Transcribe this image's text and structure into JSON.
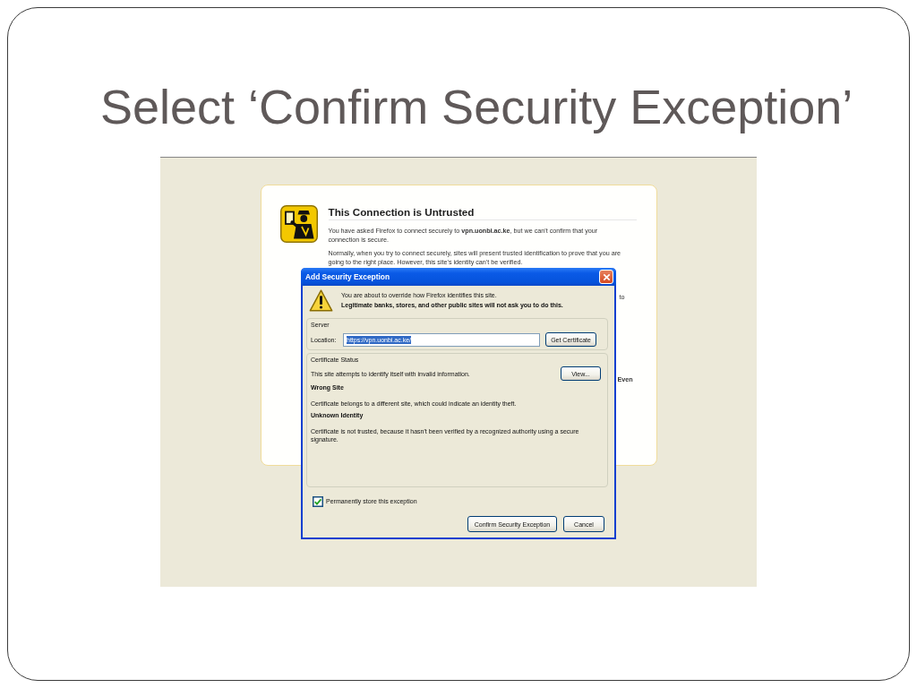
{
  "slide": {
    "title": "Select ‘Confirm Security Exception’"
  },
  "screenshot": {
    "error_page": {
      "title": "This Connection is Untrusted",
      "paragraphs": [
        "You have asked Firefox to connect securely to **vpn.uonbi.ac.ke**, but we can't confirm that your connection is secure.",
        "Normally, when you try to connect securely, sites will present trusted identification to prove that you are going to the right place. However, this site's identity can't be verified."
      ],
      "covered_fragments": [
        {
          "text": "to",
          "bold": false
        },
        {
          "text": "Even",
          "bold": true
        }
      ]
    },
    "dialog": {
      "title": "Add Security Exception",
      "warning": {
        "text": "You are about to override how Firefox identifies this site.",
        "emphasis": "Legitimate banks, stores, and other public sites will not ask you to do this."
      },
      "server": {
        "caption": "Server",
        "location_label": "Location:",
        "location_value": "https://vpn.uonbi.ac.ke/",
        "location_selected": true,
        "button": "Get Certificate"
      },
      "certificate_status": {
        "caption": "Certificate Status",
        "summary": "This site attempts to identify itself with invalid information.",
        "view_button": "View...",
        "problems": [
          {
            "heading": "Wrong Site",
            "text": "Certificate belongs to a different site, which could indicate an identity theft."
          },
          {
            "heading": "Unknown Identity",
            "text": "Certificate is not trusted, because it hasn't been verified by a recognized authority using a secure signature."
          }
        ]
      },
      "permanent": {
        "label": "Permanently store this exception",
        "checked": true
      },
      "buttons": [
        {
          "label": "Confirm Security Exception"
        },
        {
          "label": "Cancel"
        }
      ]
    }
  }
}
